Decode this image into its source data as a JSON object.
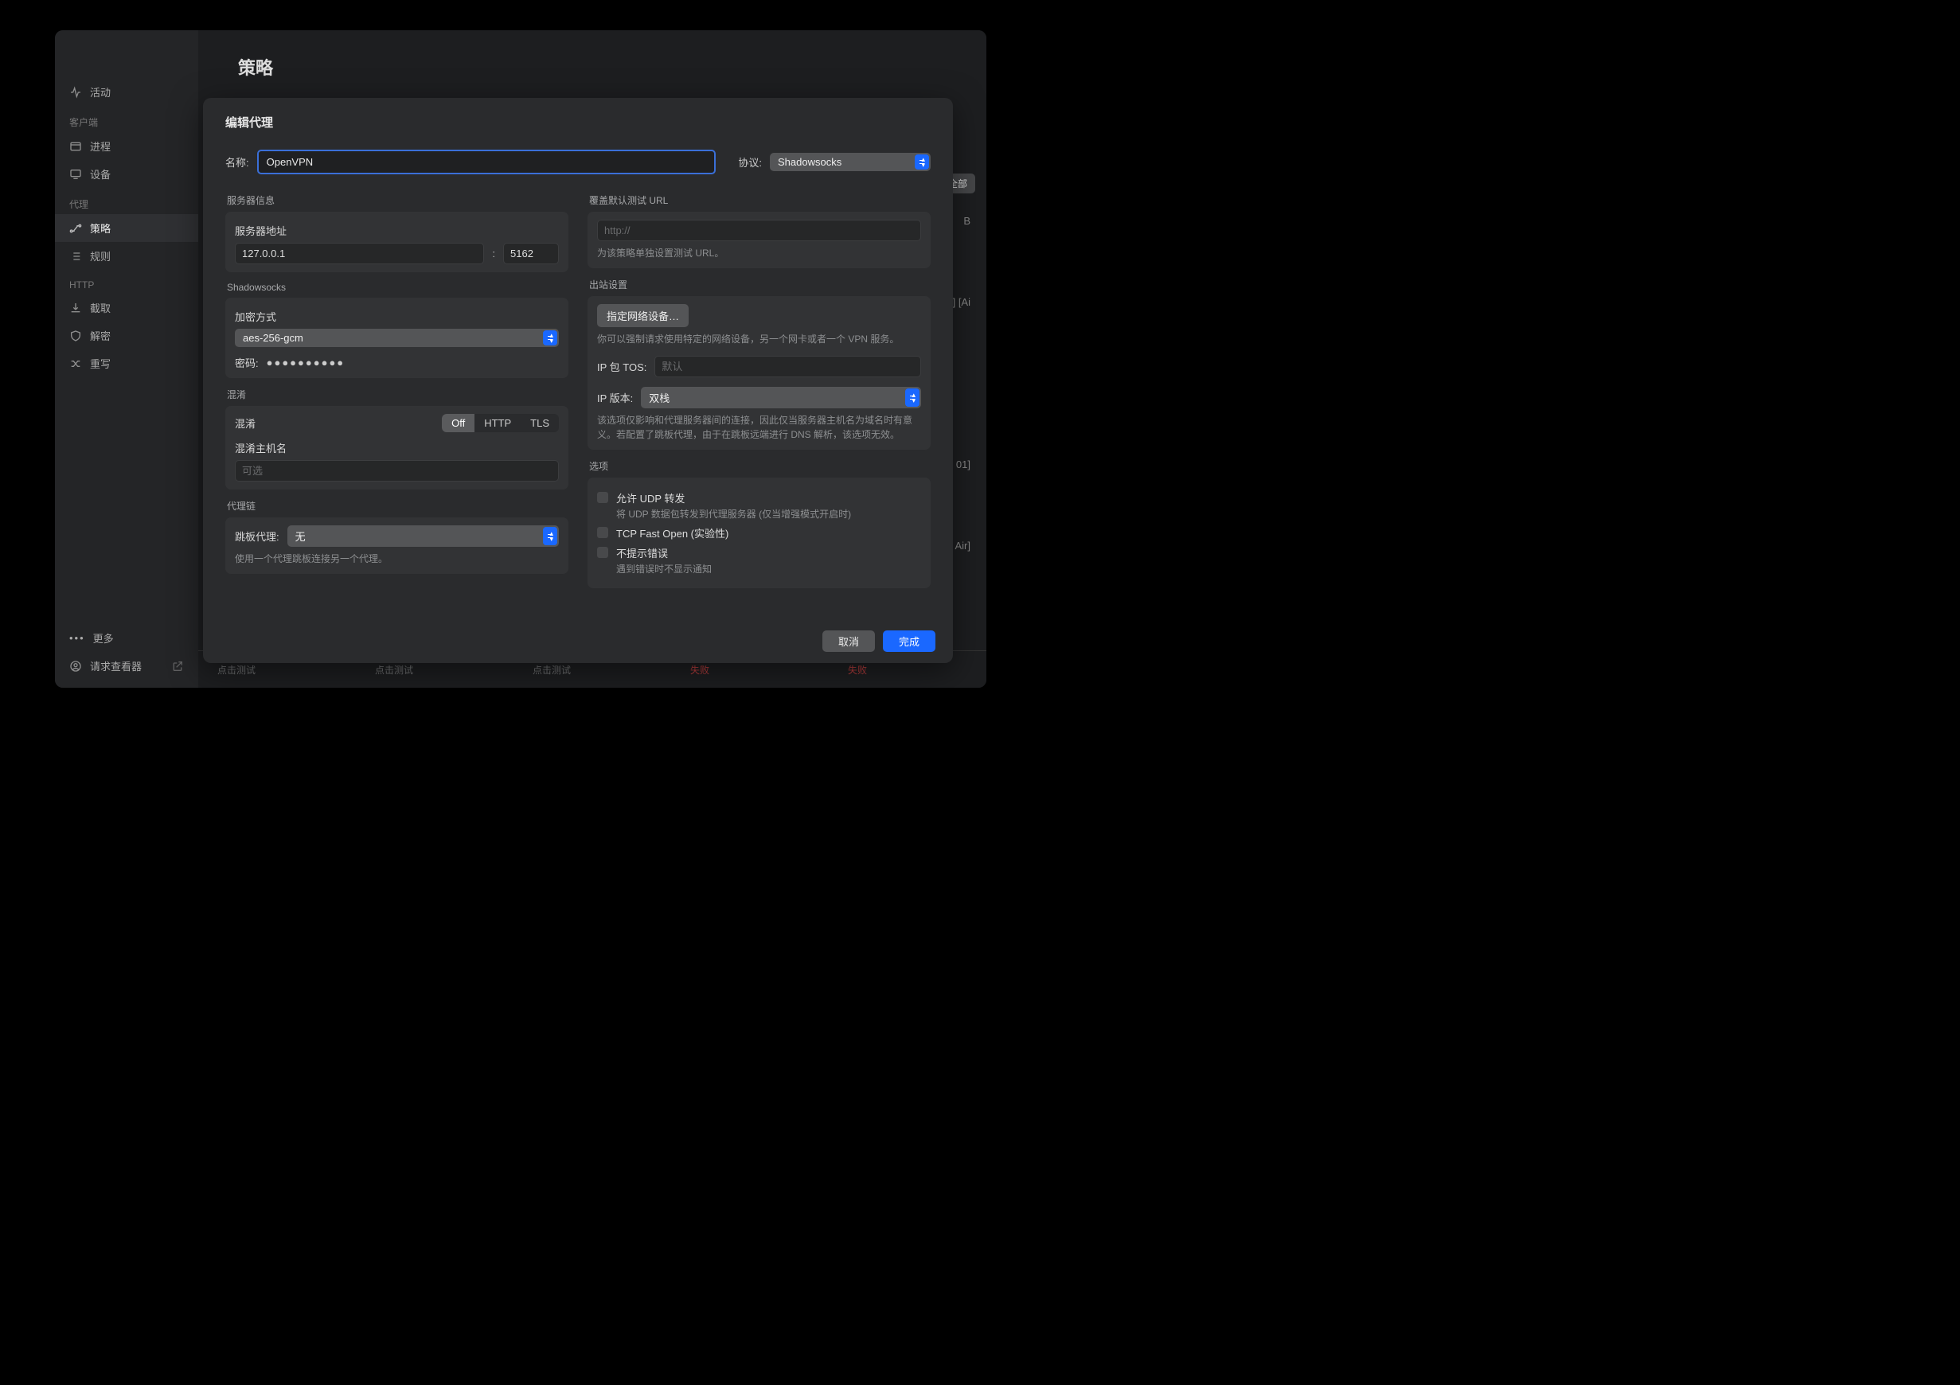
{
  "sidebar": {
    "items": [
      {
        "label": "活动"
      },
      {
        "label": "进程"
      },
      {
        "label": "设备"
      },
      {
        "label": "策略"
      },
      {
        "label": "规则"
      },
      {
        "label": "截取"
      },
      {
        "label": "解密"
      },
      {
        "label": "重写"
      }
    ],
    "headers": {
      "client": "客户端",
      "proxy": "代理",
      "http": "HTTP"
    },
    "more": "更多",
    "inspector": "请求查看器"
  },
  "content": {
    "title": "策略",
    "test_all": "测试全部",
    "bg_hints": [
      "B",
      "] [Ai",
      "01]",
      "Air]"
    ],
    "footer": [
      "点击测试",
      "点击测试",
      "点击测试",
      "失败",
      "失败"
    ]
  },
  "modal": {
    "title": "编辑代理",
    "name": {
      "label": "名称:",
      "value": "OpenVPN"
    },
    "protocol": {
      "label": "协议:",
      "value": "Shadowsocks"
    },
    "server": {
      "section": "服务器信息",
      "addr_label": "服务器地址",
      "addr_value": "127.0.0.1",
      "port_value": "5162"
    },
    "ss": {
      "section": "Shadowsocks",
      "enc_label": "加密方式",
      "enc_value": "aes-256-gcm",
      "pw_label": "密码:",
      "pw_value": "●●●●●●●●●●"
    },
    "obfs": {
      "section": "混淆",
      "title": "混淆",
      "seg": [
        "Off",
        "HTTP",
        "TLS"
      ],
      "host_label": "混淆主机名",
      "host_ph": "可选"
    },
    "chain": {
      "section": "代理链",
      "label": "跳板代理:",
      "value": "无",
      "hint": "使用一个代理跳板连接另一个代理。"
    },
    "test": {
      "section": "覆盖默认测试 URL",
      "ph": "http://",
      "hint": "为该策略单独设置测试 URL。"
    },
    "out": {
      "section": "出站设置",
      "btn": "指定网络设备…",
      "hint": "你可以强制请求使用特定的网络设备，另一个网卡或者一个 VPN 服务。",
      "tos_label": "IP 包 TOS:",
      "tos_ph": "默认",
      "ipver_label": "IP 版本:",
      "ipver_value": "双栈",
      "ipver_hint": "该选项仅影响和代理服务器间的连接，因此仅当服务器主机名为域名时有意义。若配置了跳板代理，由于在跳板远端进行 DNS 解析，该选项无效。"
    },
    "opts": {
      "section": "选项",
      "udp": {
        "t": "允许 UDP 转发",
        "sub": "将 UDP 数据包转发到代理服务器 (仅当增强模式开启时)"
      },
      "tfo": {
        "t": "TCP Fast Open (实验性)"
      },
      "silent": {
        "t": "不提示错误",
        "sub": "遇到错误时不显示通知"
      }
    },
    "cancel": "取消",
    "ok": "完成"
  }
}
